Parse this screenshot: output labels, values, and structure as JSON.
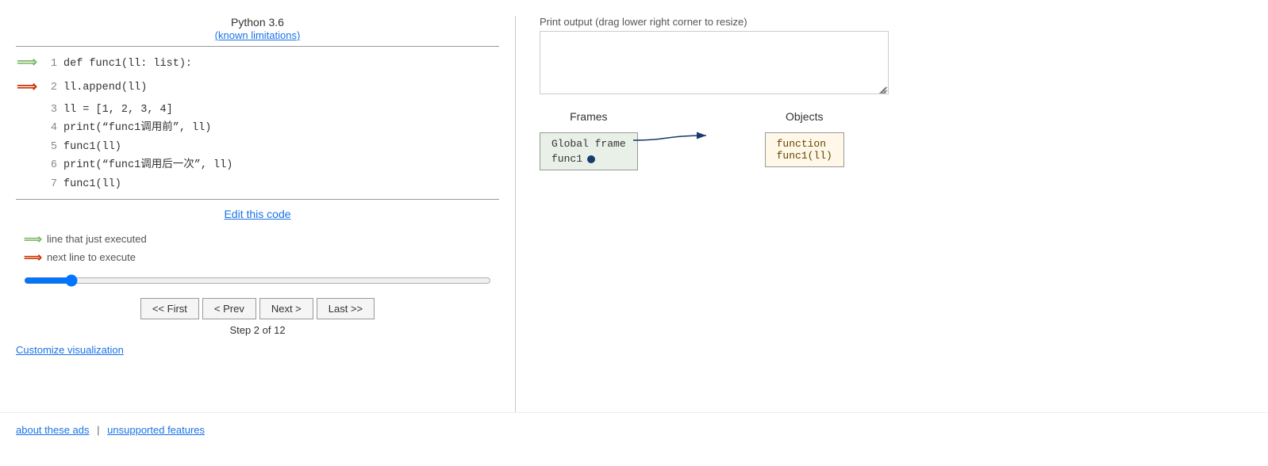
{
  "left": {
    "title": "Python 3.6",
    "known_limitations_label": "(known limitations)",
    "known_limitations_url": "#",
    "code_lines": [
      {
        "num": "1",
        "arrow": "green",
        "text": "def  func1(ll:  list):"
      },
      {
        "num": "2",
        "arrow": "red",
        "text": "        ll.append(ll)"
      },
      {
        "num": "3",
        "arrow": "",
        "text": "ll = [1,  2,  3,  4]"
      },
      {
        "num": "4",
        "arrow": "",
        "text": "print(“func1调用前”,  ll)"
      },
      {
        "num": "5",
        "arrow": "",
        "text": "func1(ll)"
      },
      {
        "num": "6",
        "arrow": "",
        "text": "print(“func1调用后一次”,  ll)"
      },
      {
        "num": "7",
        "arrow": "",
        "text": "func1(ll)"
      }
    ],
    "edit_label": "Edit this code",
    "legend": [
      {
        "arrow": "green",
        "text": "line that just executed"
      },
      {
        "arrow": "red",
        "text": "next line to execute"
      }
    ],
    "slider_min": 1,
    "slider_max": 12,
    "slider_value": 2,
    "buttons": {
      "first": "<< First",
      "prev": "< Prev",
      "next": "Next >",
      "last": "Last >>"
    },
    "step_info": "Step 2 of 12",
    "customize_label": "Customize visualization"
  },
  "right": {
    "print_label": "Print output (drag lower right corner to resize)",
    "frames_header": "Frames",
    "objects_header": "Objects",
    "global_frame_title": "Global frame",
    "frame_var": "func1",
    "object_type": "function",
    "object_value": "func1(ll)"
  },
  "footer": {
    "about_ads": "about these ads",
    "separator": "|",
    "unsupported": "unsupported features"
  }
}
